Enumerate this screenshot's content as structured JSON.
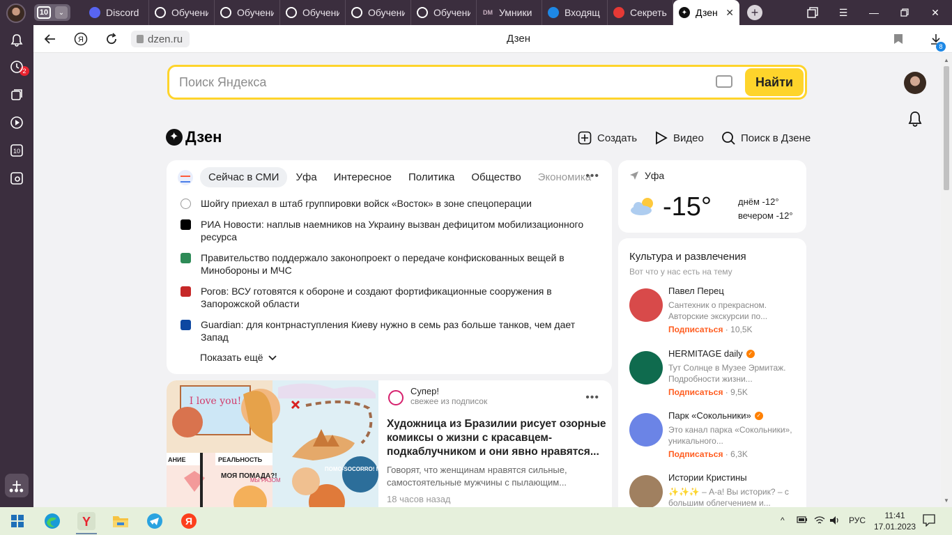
{
  "tabbar": {
    "tab_count": "10",
    "tabs": [
      {
        "label": "Discord",
        "icon": "discord-icon",
        "color": "#5865f2"
      },
      {
        "label": "Обучени",
        "icon": "openai-icon",
        "color": "#ffffff"
      },
      {
        "label": "Обучени",
        "icon": "openai-icon",
        "color": "#ffffff"
      },
      {
        "label": "Обучени",
        "icon": "openai-icon",
        "color": "#ffffff"
      },
      {
        "label": "Обучени",
        "icon": "openai-icon",
        "color": "#ffffff"
      },
      {
        "label": "Обучени",
        "icon": "openai-icon",
        "color": "#ffffff"
      },
      {
        "label": "Умники",
        "icon": "dm-icon",
        "color": "#c8b0c0"
      },
      {
        "label": "Входящ",
        "icon": "mail-icon",
        "color": "#1e88e5"
      },
      {
        "label": "Секреть",
        "icon": "bird-icon",
        "color": "#e53935"
      }
    ],
    "active_tab": {
      "label": "Дзен",
      "icon": "dzen-icon"
    }
  },
  "sidebar": {
    "notification_count": "2",
    "counter": "10"
  },
  "addressbar": {
    "url": "dzen.ru",
    "title": "Дзен",
    "downloads_count": "8"
  },
  "search": {
    "placeholder": "Поиск Яндекса",
    "button": "Найти"
  },
  "dzen": {
    "logo": "Дзен",
    "actions": [
      "Создать",
      "Видео",
      "Поиск в Дзене"
    ]
  },
  "news": {
    "tabs": [
      "Сейчас в СМИ",
      "Уфа",
      "Интересное",
      "Политика",
      "Общество",
      "Экономика"
    ],
    "items": [
      {
        "text": "Шойгу приехал в штаб группировки войск «Восток» в зоне спецоперации",
        "src_color": "#ffffff"
      },
      {
        "text": "РИА Новости: наплыв наемников на Украину вызван дефицитом мобилизационного ресурса",
        "src_color": "#000000"
      },
      {
        "text": "Правительство поддержало законопроект о передаче конфискованных вещей в Минобороны и МЧС",
        "src_color": "#2e8b57"
      },
      {
        "text": "Рогов: ВСУ готовятся к обороне и создают фортификационные сооружения в Запорожской области",
        "src_color": "#c62828"
      },
      {
        "text": "Guardian: для контрнаступления Киеву нужно в семь раз больше танков, чем дает Запад",
        "src_color": "#0d47a1"
      }
    ],
    "show_more": "Показать ещё"
  },
  "weather": {
    "city": "Уфа",
    "temp": "-15°",
    "day": "днём -12°",
    "evening": "вечером -12°"
  },
  "culture": {
    "title": "Культура и развлечения",
    "subtitle": "Вот что у нас есть на тему",
    "subscribe": "Подписаться",
    "channels": [
      {
        "name": "Павел Перец",
        "desc": "Сантехник о прекрасном. Авторские экскурсии по...",
        "subs": "10,5K",
        "verified": false,
        "color": "#d84a4a"
      },
      {
        "name": "HERMITAGE daily",
        "desc": "Тут Солнце в Музее Эрмитаж. Подробности жизни...",
        "subs": "9,5K",
        "verified": true,
        "color": "#0f6b4e"
      },
      {
        "name": "Парк «Сокольники»",
        "desc": "Это канал парка «Сокольники», уникального...",
        "subs": "6,3K",
        "verified": true,
        "color": "#6b84e6"
      },
      {
        "name": "Истории Кристины",
        "desc": "✨✨✨ – А-а! Вы историк? – с большим облегчением и...",
        "subs": "",
        "verified": false,
        "color": "#a08060"
      }
    ]
  },
  "article": {
    "source": "Супер!",
    "source_sub": "свежее из подписок",
    "title": "Художница из Бразилии рисует озорные комиксы о жизни с красавцем-подкаблучником и они явно нравятся...",
    "snippet": "Говорят, что женщинам нравятся сильные, самостоятельные мужчины с пылающим...",
    "time": "18 часов назад",
    "comic_texts": [
      "I love you!",
      "АНИЕ",
      "РЕАЛЬНОСТЬ",
      "МОЯ ПОМАДА?!",
      "МЫ РАЗОМ",
      "ПОМО-SOCORRO! ГИТЕ!!!"
    ]
  },
  "taskbar": {
    "lang": "РУС",
    "time": "11:41",
    "date": "17.01.2023"
  }
}
